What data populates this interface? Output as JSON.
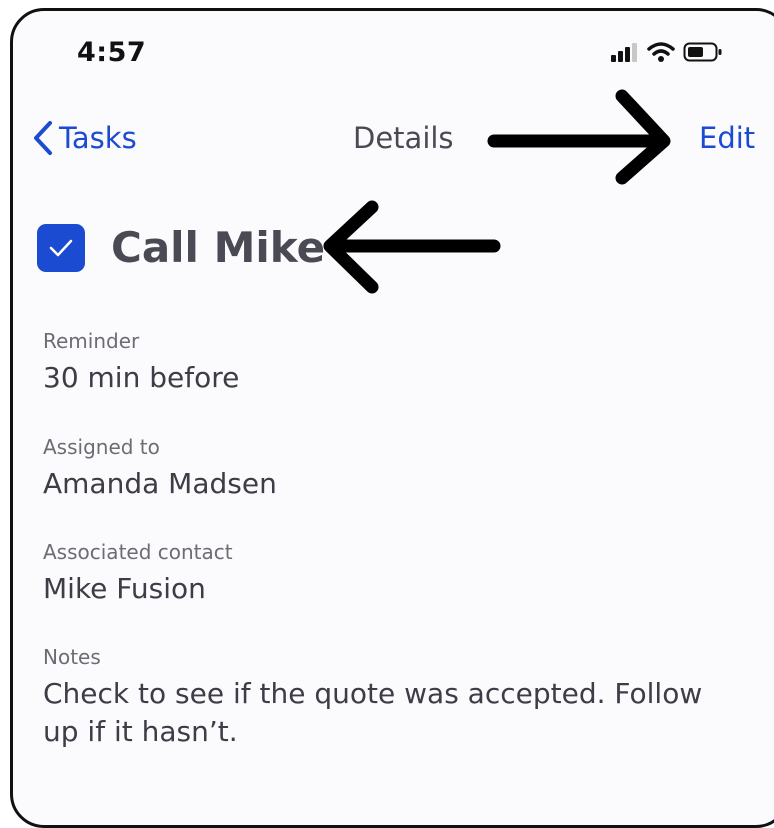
{
  "status_bar": {
    "time": "4:57",
    "icons": [
      "cellular-signal-icon",
      "wifi-icon",
      "battery-icon"
    ]
  },
  "nav": {
    "back_label": "Tasks",
    "title": "Details",
    "edit_label": "Edit"
  },
  "task": {
    "title": "Call Mike",
    "completed": true
  },
  "fields": {
    "reminder": {
      "label": "Reminder",
      "value": "30 min before"
    },
    "assigned": {
      "label": "Assigned to",
      "value": "Amanda Madsen"
    },
    "contact": {
      "label": "Associated contact",
      "value": "Mike Fusion"
    },
    "notes": {
      "label": "Notes",
      "value": "Check to see if the quote was accepted. Follow up if it hasn’t."
    }
  },
  "colors": {
    "accent": "#1a4bd0",
    "text": "#3d3d47",
    "label": "#6c6c75",
    "annotation": "#000000"
  }
}
